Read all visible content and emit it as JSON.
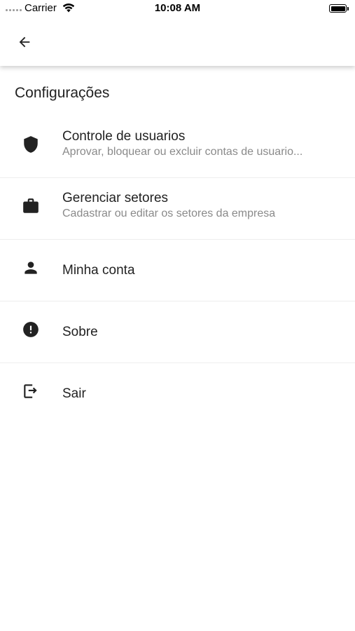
{
  "status_bar": {
    "carrier": "Carrier",
    "time": "10:08 AM"
  },
  "app_bar": {
    "back_icon": "arrow-back-icon"
  },
  "page": {
    "title": "Configurações"
  },
  "settings": [
    {
      "icon": "shield-icon",
      "title": "Controle de usuarios",
      "subtitle": "Aprovar, bloquear ou excluir contas de usuario..."
    },
    {
      "icon": "briefcase-icon",
      "title": "Gerenciar setores",
      "subtitle": "Cadastrar ou editar os setores da empresa"
    },
    {
      "icon": "person-icon",
      "title": "Minha conta",
      "subtitle": ""
    },
    {
      "icon": "info-alert-icon",
      "title": "Sobre",
      "subtitle": ""
    },
    {
      "icon": "exit-icon",
      "title": "Sair",
      "subtitle": ""
    }
  ],
  "colors": {
    "background": "#ffffff",
    "text_primary": "#222222",
    "text_secondary": "#8a8a8a",
    "divider": "#eeeeee"
  }
}
